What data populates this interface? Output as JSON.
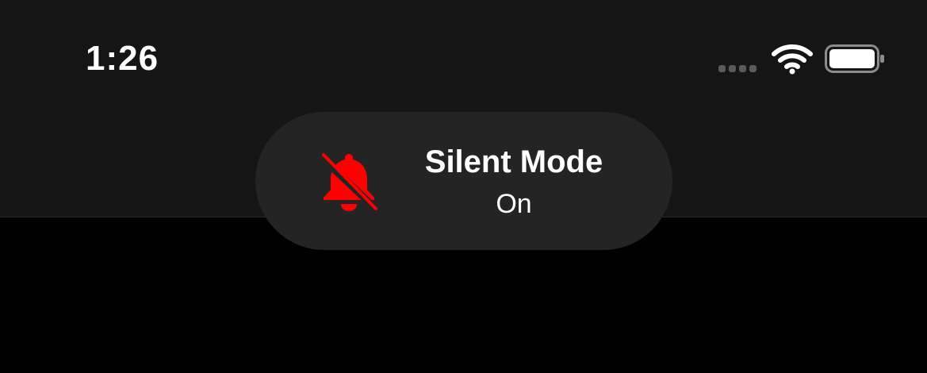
{
  "status_bar": {
    "time": "1:26",
    "icons": [
      "cellular-signal-icon",
      "wifi-icon",
      "battery-icon"
    ]
  },
  "toast": {
    "icon": "bell-slash-icon",
    "title": "Silent Mode",
    "subtitle": "On"
  },
  "colors": {
    "background": "#000000",
    "topbar": "#151515",
    "toast": "#242424",
    "bell_icon": "#ff0000",
    "text": "#ffffff",
    "signal_inactive": "#5a5a5a"
  }
}
